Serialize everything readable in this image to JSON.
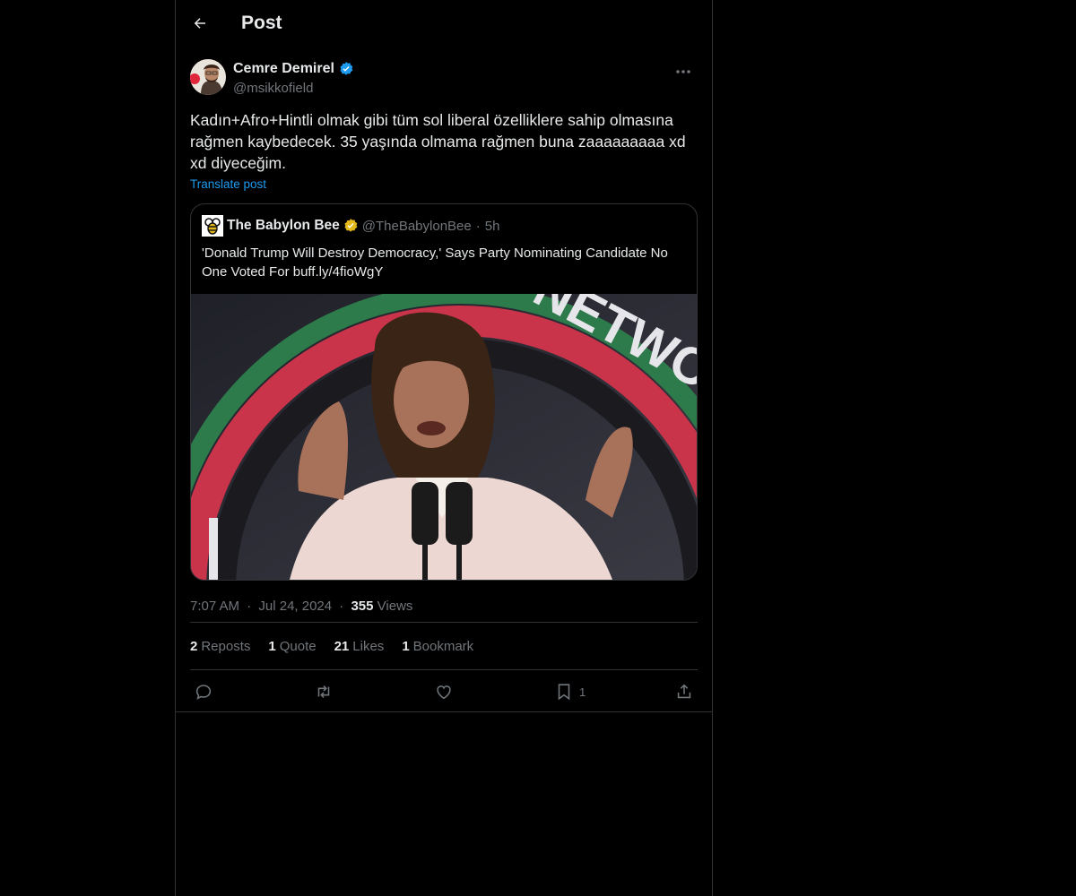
{
  "header": {
    "title": "Post",
    "back_icon": "arrow-left-icon"
  },
  "author": {
    "name": "Cemre Demirel",
    "handle": "@msikkofield",
    "verified_color": "#1d9bf0"
  },
  "post": {
    "text": "Kadın+Afro+Hintli olmak gibi tüm sol liberal özelliklere sahip olmasına rağmen kaybedecek. 35 yaşında olmama rağmen buna zaaaaaaaaa xd xd diyeceğim.",
    "translate_label": "Translate post"
  },
  "quote": {
    "name": "The Babylon Bee",
    "handle": "@TheBabylonBee",
    "separator": "·",
    "time": "5h",
    "text": "'Donald Trump Will Destroy Democracy,' Says Party Nominating Candidate No One Voted For buff.ly/4fioWgY",
    "badge_color": "#e2b719"
  },
  "meta": {
    "time": "7:07 AM",
    "dot": "·",
    "date": "Jul 24, 2024",
    "views_count": "355",
    "views_label": "Views"
  },
  "stats": [
    {
      "count": "2",
      "label": "Reposts"
    },
    {
      "count": "1",
      "label": "Quote"
    },
    {
      "count": "21",
      "label": "Likes"
    },
    {
      "count": "1",
      "label": "Bookmark"
    }
  ],
  "actions": {
    "reply_icon": "reply-icon",
    "repost_icon": "repost-icon",
    "like_icon": "heart-icon",
    "bookmark_icon": "bookmark-icon",
    "bookmark_count": "1",
    "share_icon": "share-icon"
  },
  "colors": {
    "accent": "#1d9bf0",
    "muted": "#71767b",
    "border": "#2f3336",
    "background": "#000000"
  }
}
